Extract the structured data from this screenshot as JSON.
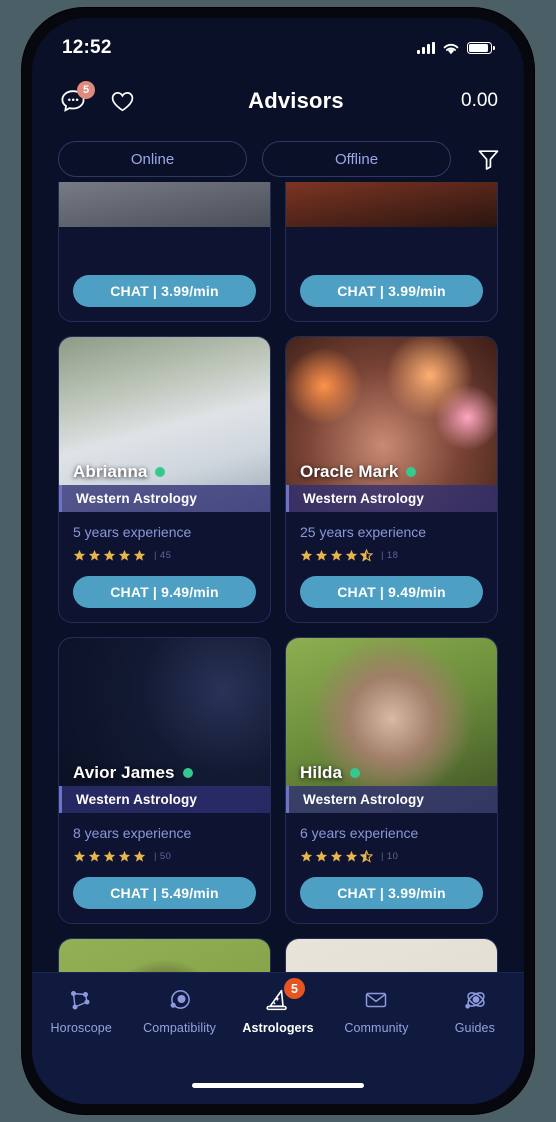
{
  "status_bar": {
    "time": "12:52",
    "signal_icon": "cellular-signal-icon",
    "wifi_icon": "wifi-icon",
    "battery_icon": "battery-icon"
  },
  "header": {
    "messages_icon": "chat-bubble-icon",
    "messages_badge": "5",
    "favorites_icon": "heart-icon",
    "title": "Advisors",
    "balance": "0.00"
  },
  "filters": {
    "online_label": "Online",
    "offline_label": "Offline",
    "filter_icon": "funnel-icon"
  },
  "colors": {
    "screen_bg": "#0a1027",
    "card_bg": "#0d1330",
    "card_border": "#232e58",
    "chat_button": "#4e9fc4",
    "online_dot": "#35c98f",
    "star_gold": "#e8b54a",
    "nav_bg": "#101a3e",
    "nav_badge": "#e8541f",
    "header_badge": "#e08a7e",
    "pill_border": "#2c3a66",
    "pill_text": "#9aa8e8",
    "spec_bar": "#2e3073",
    "experience_text": "#8b97d8"
  },
  "advisors": [
    {
      "name": "",
      "specialty": "",
      "experience": "",
      "stars": 0,
      "half_star": false,
      "reviews": "",
      "chat_label": "CHAT | 3.99/min",
      "online": false,
      "photo": "partial-top-card-left",
      "partial_top": true
    },
    {
      "name": "",
      "specialty": "",
      "experience": "",
      "stars": 0,
      "half_star": false,
      "reviews": "",
      "chat_label": "CHAT | 3.99/min",
      "online": false,
      "photo": "partial-top-card-right",
      "partial_top": true
    },
    {
      "name": "Abrianna",
      "specialty": "Western Astrology",
      "experience": "5 years experience",
      "stars": 5,
      "half_star": false,
      "reviews": "| 45",
      "chat_label": "CHAT | 9.49/min",
      "online": true,
      "photo": "woman-white-blazer-blue-hydrangeas"
    },
    {
      "name": "Oracle Mark",
      "specialty": "Western Astrology",
      "experience": "25 years experience",
      "stars": 4,
      "half_star": true,
      "reviews": "| 18",
      "chat_label": "CHAT | 9.49/min",
      "online": true,
      "photo": "man-glasses-orange-bokeh-lights"
    },
    {
      "name": "Avior James",
      "specialty": "Western Astrology",
      "experience": "8 years experience",
      "stars": 5,
      "half_star": false,
      "reviews": "| 50",
      "chat_label": "CHAT | 5.49/min",
      "online": true,
      "photo": "man-glasses-starfield-night-sky"
    },
    {
      "name": "Hilda",
      "specialty": "Western Astrology",
      "experience": "6 years experience",
      "stars": 4,
      "half_star": true,
      "reviews": "| 10",
      "chat_label": "CHAT | 3.99/min",
      "online": true,
      "photo": "woman-bangs-green-foliage"
    },
    {
      "name": "",
      "specialty": "",
      "experience": "",
      "stars": 0,
      "half_star": false,
      "reviews": "",
      "chat_label": "",
      "online": false,
      "photo": "partial-bottom-card-left-woman-green-background",
      "partial_bottom": true
    },
    {
      "name": "",
      "specialty": "",
      "experience": "",
      "stars": 0,
      "half_star": false,
      "reviews": "",
      "chat_label": "",
      "online": false,
      "photo": "partial-bottom-card-right-woman-cream-background",
      "partial_bottom": true
    }
  ],
  "bottom_nav": {
    "items": [
      {
        "label": "Horoscope",
        "icon": "constellation-icon",
        "active": false,
        "badge": ""
      },
      {
        "label": "Compatibility",
        "icon": "planet-orbit-icon",
        "active": false,
        "badge": ""
      },
      {
        "label": "Astrologers",
        "icon": "wizard-hat-icon",
        "active": true,
        "badge": "5"
      },
      {
        "label": "Community",
        "icon": "envelope-icon",
        "active": false,
        "badge": ""
      },
      {
        "label": "Guides",
        "icon": "atom-orbit-icon",
        "active": false,
        "badge": ""
      }
    ]
  }
}
